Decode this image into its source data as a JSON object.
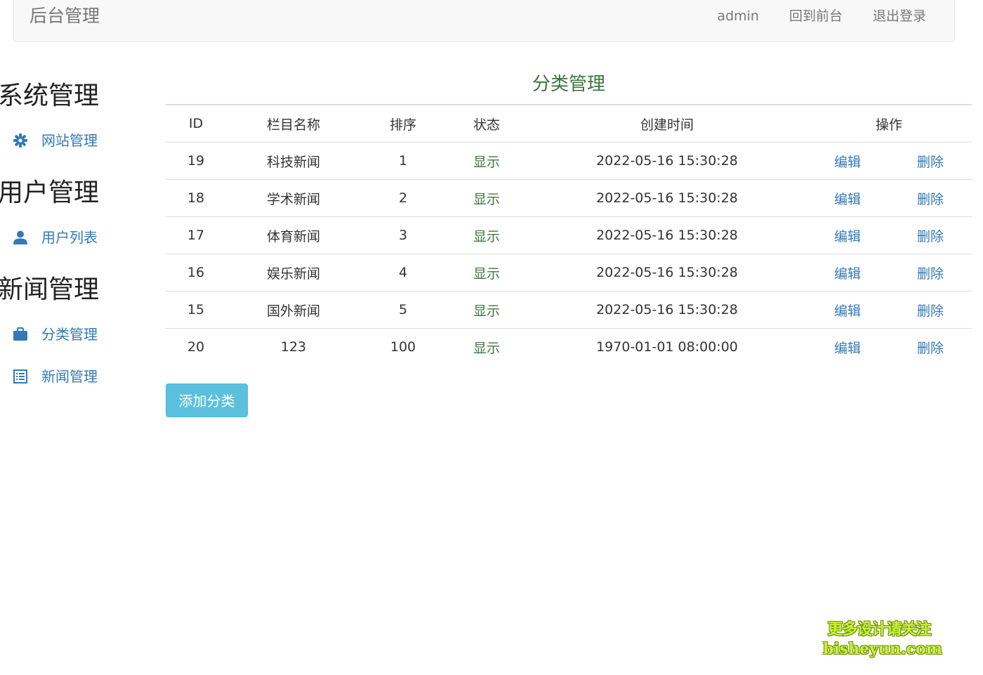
{
  "navbar": {
    "brand": "后台管理",
    "links": [
      "admin",
      "回到前台",
      "退出登录"
    ]
  },
  "sidebar": {
    "groups": [
      {
        "title": "系统管理",
        "items": [
          {
            "label": "网站管理",
            "icon": "gear-icon"
          }
        ]
      },
      {
        "title": "用户管理",
        "items": [
          {
            "label": "用户列表",
            "icon": "user-icon"
          }
        ]
      },
      {
        "title": "新闻管理",
        "items": [
          {
            "label": "分类管理",
            "icon": "briefcase-icon"
          },
          {
            "label": "新闻管理",
            "icon": "list-icon"
          }
        ]
      }
    ]
  },
  "main": {
    "title": "分类管理",
    "columns": [
      "ID",
      "栏目名称",
      "排序",
      "状态",
      "创建时间",
      "操作"
    ],
    "rows": [
      {
        "id": "19",
        "name": "科技新闻",
        "sort": "1",
        "status": "显示",
        "created": "2022-05-16 15:30:28",
        "edit": "编辑",
        "delete": "删除"
      },
      {
        "id": "18",
        "name": "学术新闻",
        "sort": "2",
        "status": "显示",
        "created": "2022-05-16 15:30:28",
        "edit": "编辑",
        "delete": "删除"
      },
      {
        "id": "17",
        "name": "体育新闻",
        "sort": "3",
        "status": "显示",
        "created": "2022-05-16 15:30:28",
        "edit": "编辑",
        "delete": "删除"
      },
      {
        "id": "16",
        "name": "娱乐新闻",
        "sort": "4",
        "status": "显示",
        "created": "2022-05-16 15:30:28",
        "edit": "编辑",
        "delete": "删除"
      },
      {
        "id": "15",
        "name": "国外新闻",
        "sort": "5",
        "status": "显示",
        "created": "2022-05-16 15:30:28",
        "edit": "编辑",
        "delete": "删除"
      },
      {
        "id": "20",
        "name": "123",
        "sort": "100",
        "status": "显示",
        "created": "1970-01-01 08:00:00",
        "edit": "编辑",
        "delete": "删除"
      }
    ],
    "add_button": "添加分类"
  },
  "watermark": {
    "line1": "更多设计请关注",
    "line2": "bisheyun.com"
  },
  "colors": {
    "link": "#337ab7",
    "status_green": "#3c763d",
    "button_info": "#5bc0de",
    "navbar_bg": "#f8f8f8",
    "watermark": "#c9f23a"
  }
}
